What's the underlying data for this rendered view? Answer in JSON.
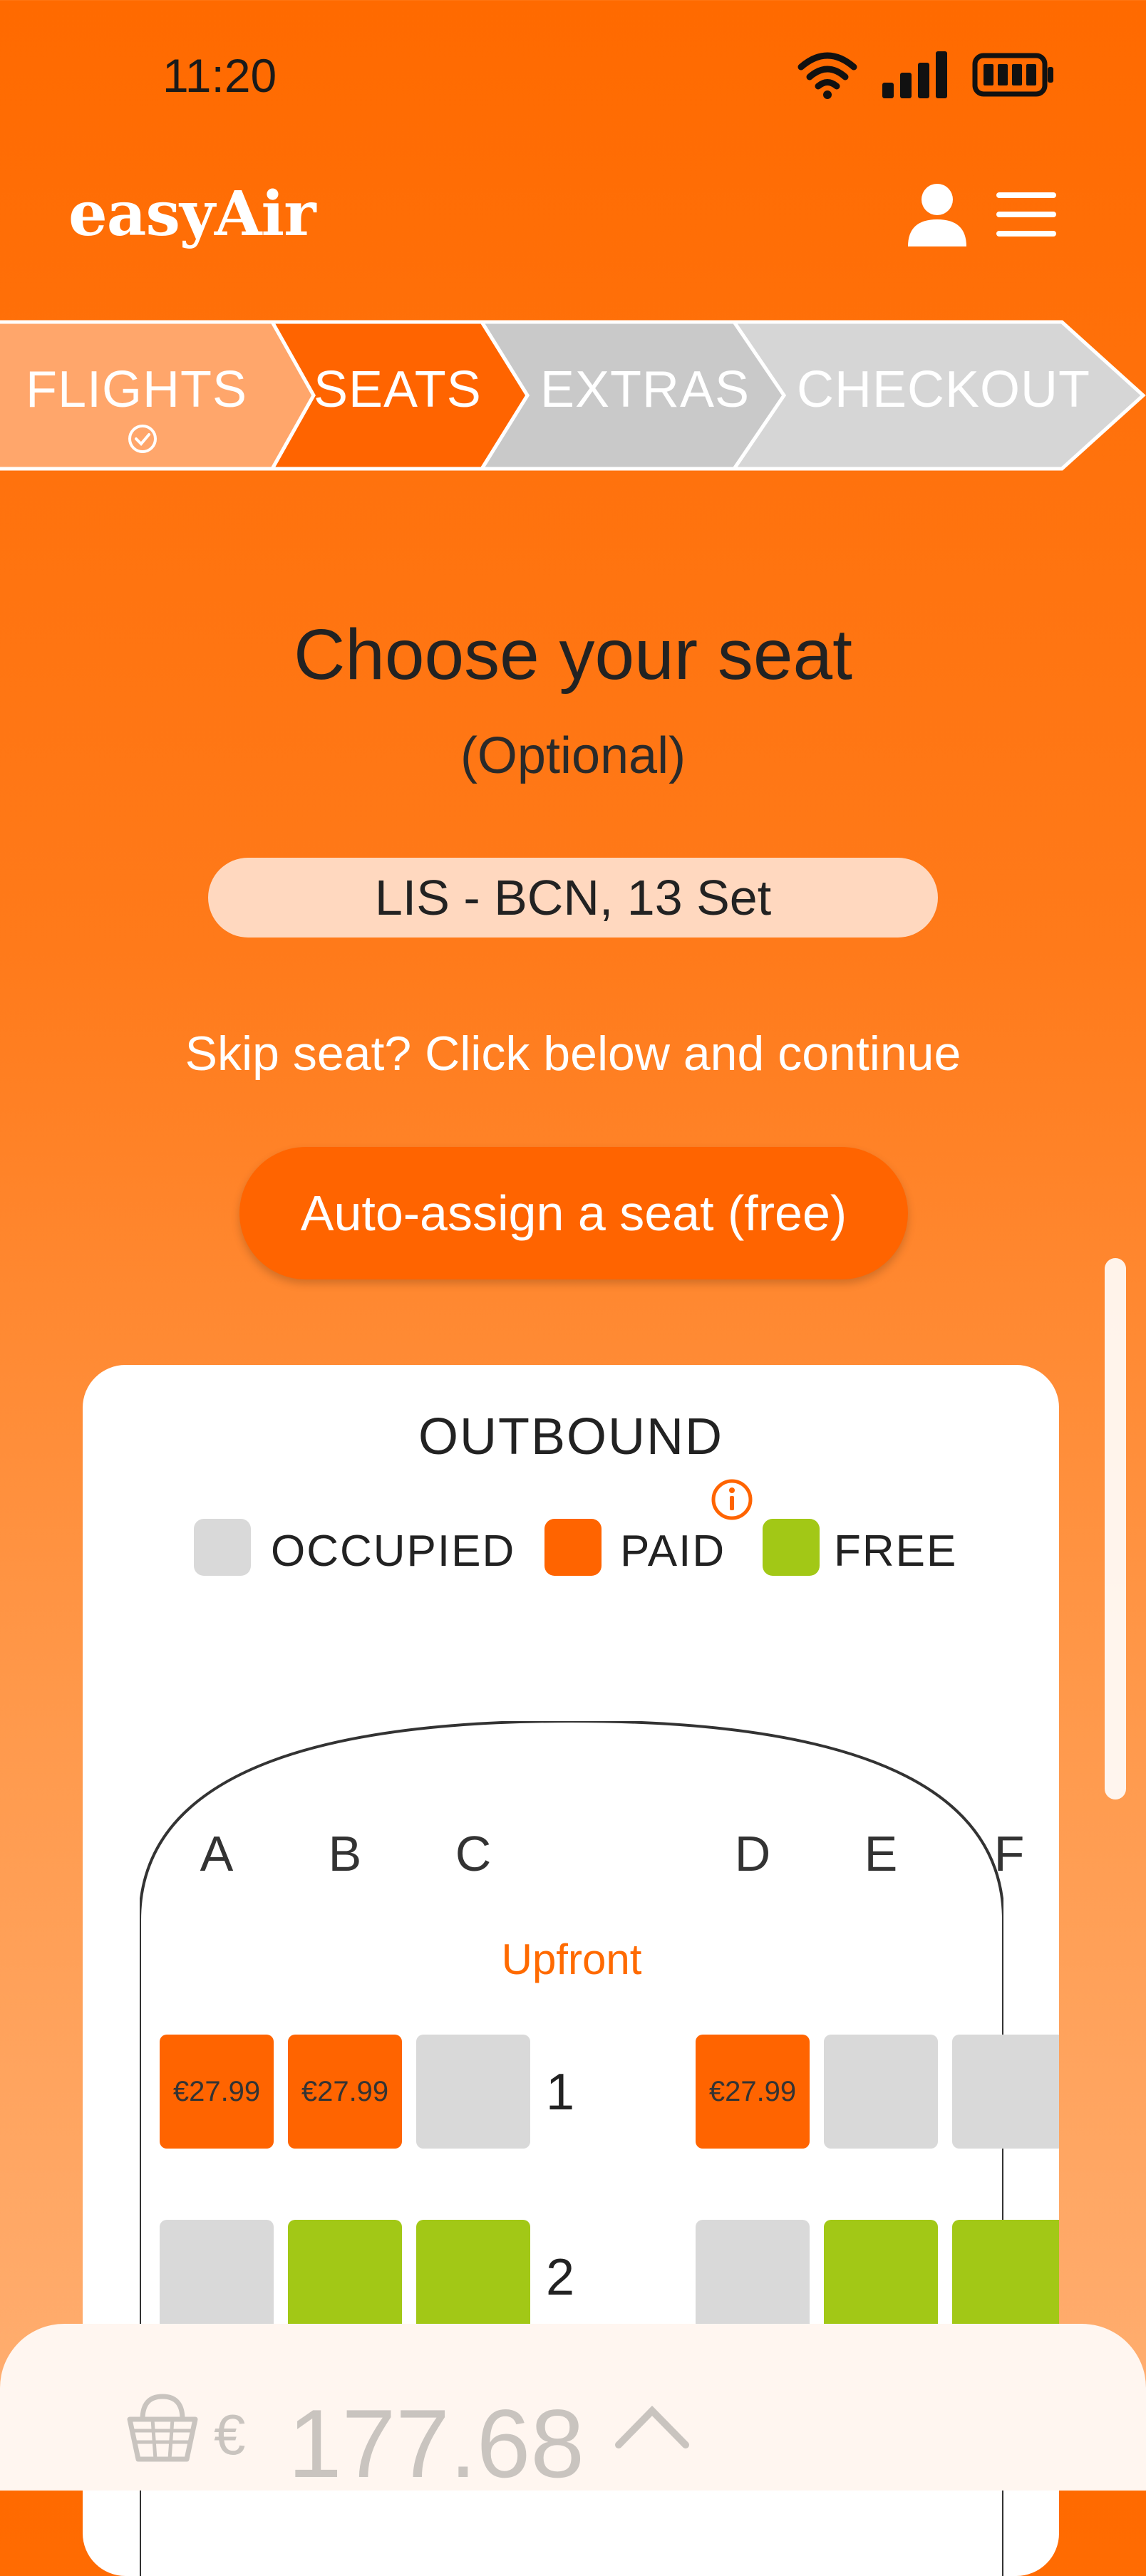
{
  "status": {
    "time": "11:20"
  },
  "header": {
    "logo": "easyAir"
  },
  "steps": [
    {
      "label": "FLIGHTS",
      "state": "done"
    },
    {
      "label": "SEATS",
      "state": "active"
    },
    {
      "label": "EXTRAS",
      "state": "todo"
    },
    {
      "label": "CHECKOUT",
      "state": "todo"
    }
  ],
  "main": {
    "title": "Choose your seat",
    "subtitle": "(Optional)",
    "route": "LIS - BCN, 13 Set",
    "skip_text": "Skip seat? Click below and continue",
    "auto_assign_label": "Auto-assign a seat (free)"
  },
  "seat_map": {
    "title": "OUTBOUND",
    "legend": [
      {
        "label": "OCCUPIED",
        "color": "#d9d9d9"
      },
      {
        "label": "PAID",
        "color": "#ff6400"
      },
      {
        "label": "FREE",
        "color": "#a2c816"
      }
    ],
    "columns": [
      "A",
      "B",
      "C",
      "D",
      "E",
      "F"
    ],
    "section": "Upfront",
    "rows": [
      {
        "number": "1",
        "seats": [
          {
            "status": "paid",
            "price": "€27.99"
          },
          {
            "status": "paid",
            "price": "€27.99"
          },
          {
            "status": "occupied",
            "price": ""
          },
          {
            "status": "paid",
            "price": "€27.99"
          },
          {
            "status": "occupied",
            "price": ""
          },
          {
            "status": "occupied",
            "price": ""
          }
        ]
      },
      {
        "number": "2",
        "seats": [
          {
            "status": "occupied",
            "price": ""
          },
          {
            "status": "free",
            "price": ""
          },
          {
            "status": "free",
            "price": ""
          },
          {
            "status": "occupied",
            "price": ""
          },
          {
            "status": "free",
            "price": ""
          },
          {
            "status": "free",
            "price": ""
          }
        ]
      }
    ]
  },
  "basket": {
    "currency": "€",
    "total": "177.68"
  },
  "colors": {
    "brand": "#ff6a00",
    "paid": "#ff6400",
    "free": "#a2c816",
    "occupied": "#d9d9d9"
  }
}
